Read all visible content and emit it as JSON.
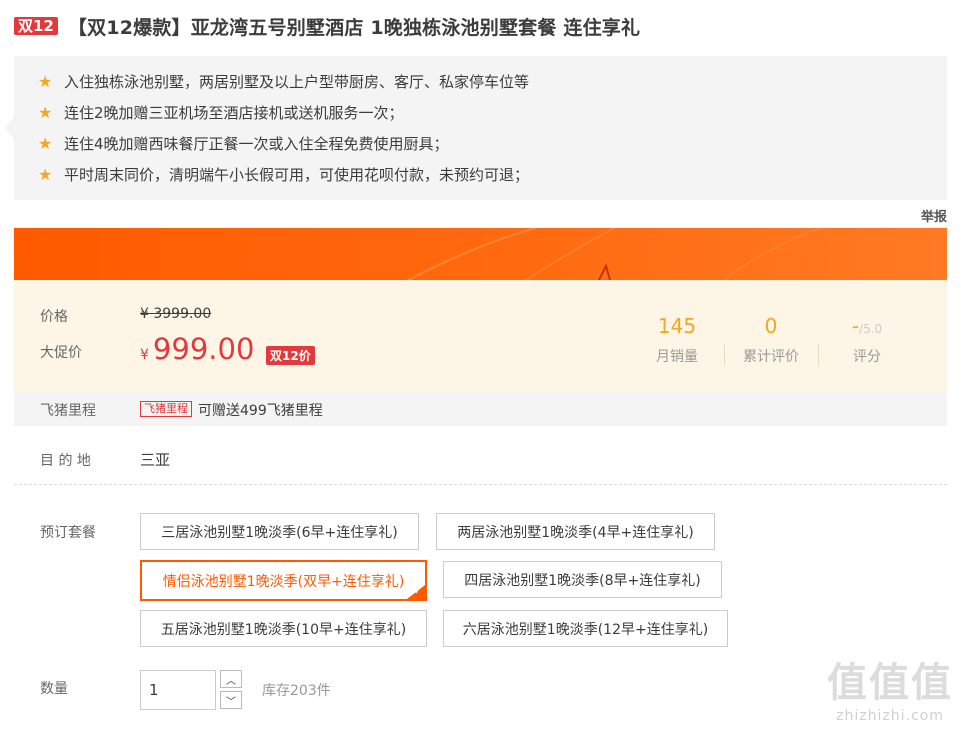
{
  "title": {
    "tag": "双12",
    "text": "【双12爆款】亚龙湾五号别墅酒店 1晚独栋泳池别墅套餐 连住享礼"
  },
  "highlights": [
    "入住独栋泳池别墅，两居别墅及以上户型带厨房、客厅、私家停车位等",
    "连住2晚加赠三亚机场至酒店接机或送机服务一次；",
    "连住4晚加赠西味餐厅正餐一次或入住全程免费使用厨具；",
    "平时周末同价，清明端午小长假可用，可使用花呗付款，未预约可退；"
  ],
  "report_label": "举报",
  "price": {
    "price_label": "价格",
    "original": "¥ 3999.00",
    "promo_label": "大促价",
    "currency": "¥",
    "promo_value": "999.00",
    "promo_badge": "双12价"
  },
  "stats": [
    {
      "value": "145",
      "caption": "月销量"
    },
    {
      "value": "0",
      "caption": "累计评价"
    },
    {
      "value": "-",
      "suffix": "/5.0",
      "caption": "评分"
    }
  ],
  "miles": {
    "label": "飞猪里程",
    "tag": "飞猪里程",
    "text": "可赠送499飞猪里程"
  },
  "destination": {
    "label": "目 的 地",
    "value": "三亚"
  },
  "packages": {
    "label": "预订套餐",
    "options": [
      "三居泳池别墅1晚淡季(6早+连住享礼)",
      "两居泳池别墅1晚淡季(4早+连住享礼)",
      "情侣泳池别墅1晚淡季(双早+连住享礼)",
      "四居泳池别墅1晚淡季(8早+连住享礼)",
      "五居泳池别墅1晚淡季(10早+连住享礼)",
      "六居泳池别墅1晚淡季(12早+连住享礼)"
    ],
    "selected_index": 2
  },
  "quantity": {
    "label": "数量",
    "value": "1",
    "stock": "库存203件"
  },
  "watermark": {
    "big": "值值值",
    "small": "zhizhizhi.com"
  },
  "colors": {
    "accent": "#ff5a00",
    "price_red": "#e4393c",
    "stat_orange": "#f5a623"
  }
}
